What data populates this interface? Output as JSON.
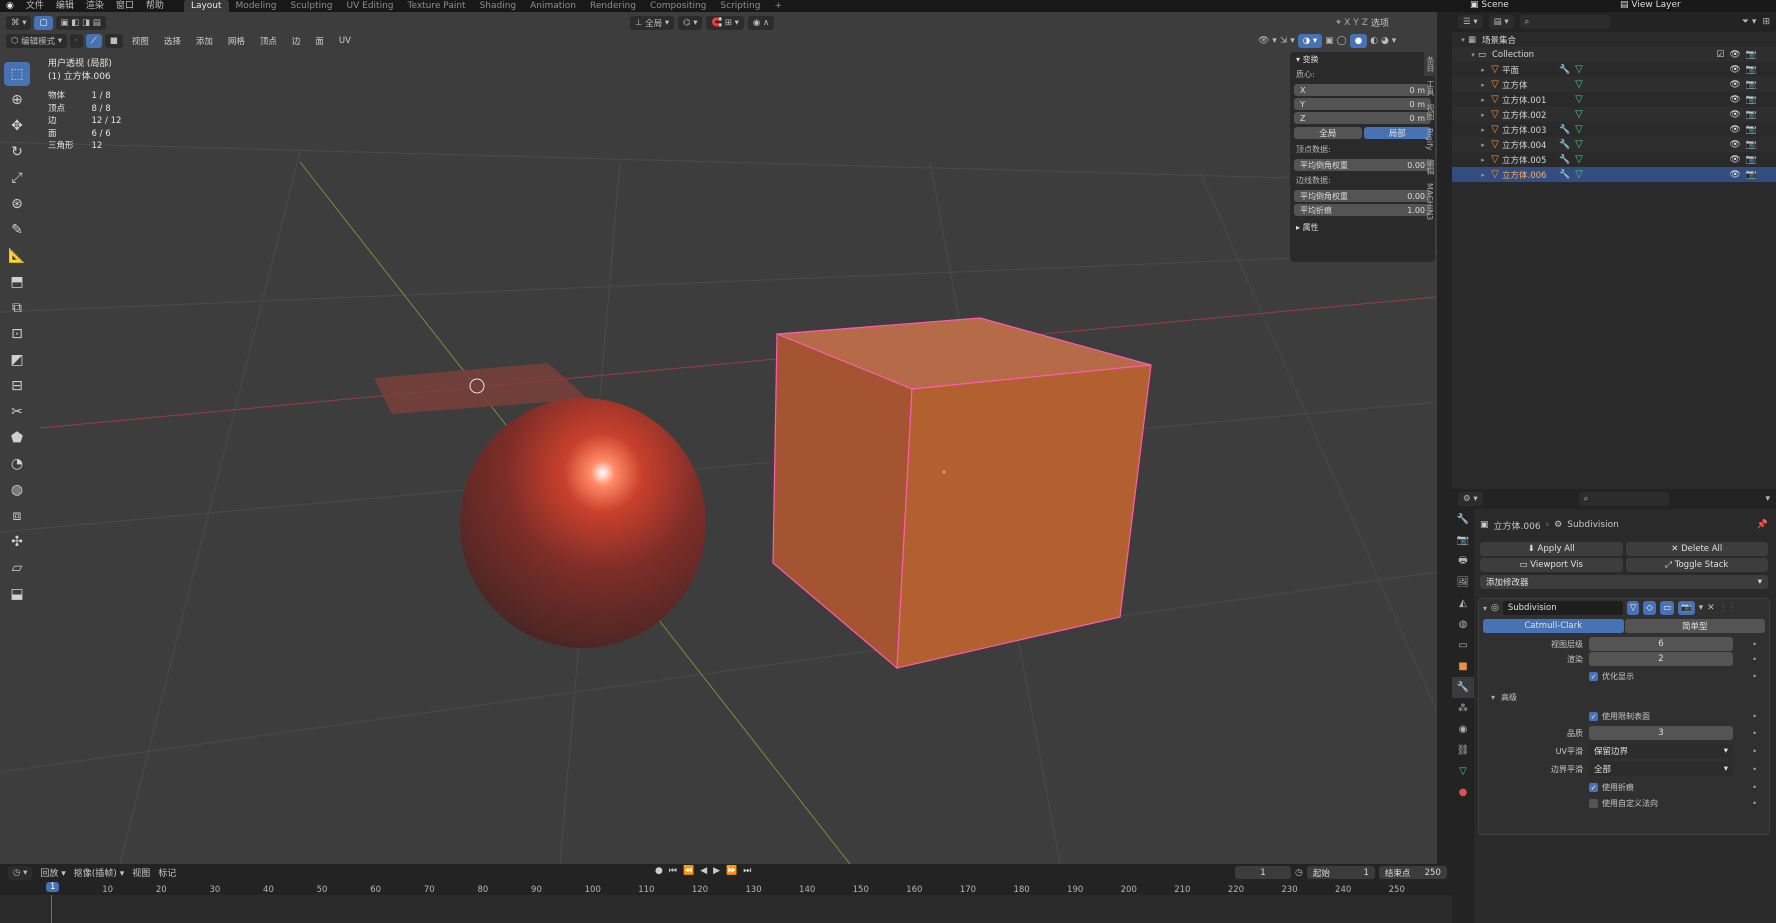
{
  "menu": {
    "app_menu": [
      "文件",
      "编辑",
      "渲染",
      "窗口",
      "帮助"
    ],
    "workspaces": [
      "Layout",
      "Modeling",
      "Sculpting",
      "UV Editing",
      "Texture Paint",
      "Shading",
      "Animation",
      "Rendering",
      "Compositing",
      "Scripting"
    ],
    "active_workspace": "Layout",
    "scene_label": "Scene",
    "view_layer_label": "View Layer",
    "add_tab": "+"
  },
  "viewport_header": {
    "mode": "编辑模式",
    "menus": [
      "视图",
      "选择",
      "添加",
      "网格",
      "顶点",
      "边",
      "面",
      "UV"
    ],
    "transform_orientation": "全局",
    "snap_label": "选项",
    "axis_labels": [
      "X",
      "Y",
      "Z"
    ]
  },
  "overlay": {
    "view_name": "用户透视 (局部)",
    "object_name": "(1) 立方体.006",
    "stats": [
      {
        "label": "物体",
        "value": "1 / 8"
      },
      {
        "label": "顶点",
        "value": "8 / 8"
      },
      {
        "label": "边",
        "value": "12 / 12"
      },
      {
        "label": "面",
        "value": "6 / 6"
      },
      {
        "label": "三角形",
        "value": "12"
      }
    ]
  },
  "npanel": {
    "section_transform": "变换",
    "median_label": "质心:",
    "x": {
      "label": "X",
      "value": "0 m"
    },
    "y": {
      "label": "Y",
      "value": "0 m"
    },
    "z": {
      "label": "Z",
      "value": "0 m"
    },
    "space_global": "全局",
    "space_local": "局部",
    "vertex_data_label": "顶点数据:",
    "vertex_crease": {
      "label": "平均倒角权重",
      "value": "0.00"
    },
    "edge_data_label": "边线数据:",
    "edge_bevel": {
      "label": "平均倒角权重",
      "value": "0.00"
    },
    "edge_crease": {
      "label": "平均折痕",
      "value": "1.00"
    },
    "section_properties": "属性",
    "side_tabs": [
      "条目",
      "工具",
      "视图",
      "Rigify",
      "编辑",
      "MACHIN3"
    ]
  },
  "outliner": {
    "root": "场景集合",
    "collection": "Collection",
    "items": [
      {
        "name": "平面",
        "has_modifier": true
      },
      {
        "name": "立方体",
        "has_modifier": false
      },
      {
        "name": "立方体.001",
        "has_modifier": false
      },
      {
        "name": "立方体.002",
        "has_modifier": false
      },
      {
        "name": "立方体.003",
        "has_modifier": true
      },
      {
        "name": "立方体.004",
        "has_modifier": true
      },
      {
        "name": "立方体.005",
        "has_modifier": true
      },
      {
        "name": "立方体.006",
        "has_modifier": true,
        "selected": true
      }
    ]
  },
  "properties": {
    "object_name": "立方体.006",
    "modifier_context": "Subdivision",
    "apply_all": "Apply All",
    "delete_all": "Delete All",
    "viewport_vis": "Viewport Vis",
    "toggle_stack": "Toggle Stack",
    "add_modifier": "添加修改器",
    "modifier_name": "Subdivision",
    "catmull_clark": "Catmull-Clark",
    "simple": "简单型",
    "levels_viewport": {
      "label": "视图层级",
      "value": "6"
    },
    "render": {
      "label": "渲染",
      "value": "2"
    },
    "optimal_display": "优化显示",
    "advanced": "高级",
    "use_limit_surface": "使用限制表面",
    "quality": {
      "label": "品质",
      "value": "3"
    },
    "uv_smooth": {
      "label": "UV平滑",
      "value": "保留边界"
    },
    "boundary_smooth": {
      "label": "边界平滑",
      "value": "全部"
    },
    "use_creases": "使用折痕",
    "use_custom_normals": "使用自定义法向"
  },
  "timeline": {
    "playback": "回放",
    "keying": "抠像(插帧)",
    "view": "视图",
    "marker": "标记",
    "current_frame": "1",
    "start_label": "起始",
    "start": "1",
    "end_label": "结束点",
    "end": "250",
    "ticks": [
      "1",
      "10",
      "20",
      "30",
      "40",
      "50",
      "60",
      "70",
      "80",
      "90",
      "100",
      "110",
      "120",
      "130",
      "140",
      "150",
      "160",
      "170",
      "180",
      "190",
      "200",
      "210",
      "220",
      "230",
      "240",
      "250"
    ]
  },
  "colors": {
    "accent": "#4772b3",
    "selected_object": "#ffb060",
    "cube": "#b35a2e",
    "sphere": "#8a2f26",
    "edge_highlight": "#ff5cb0"
  }
}
